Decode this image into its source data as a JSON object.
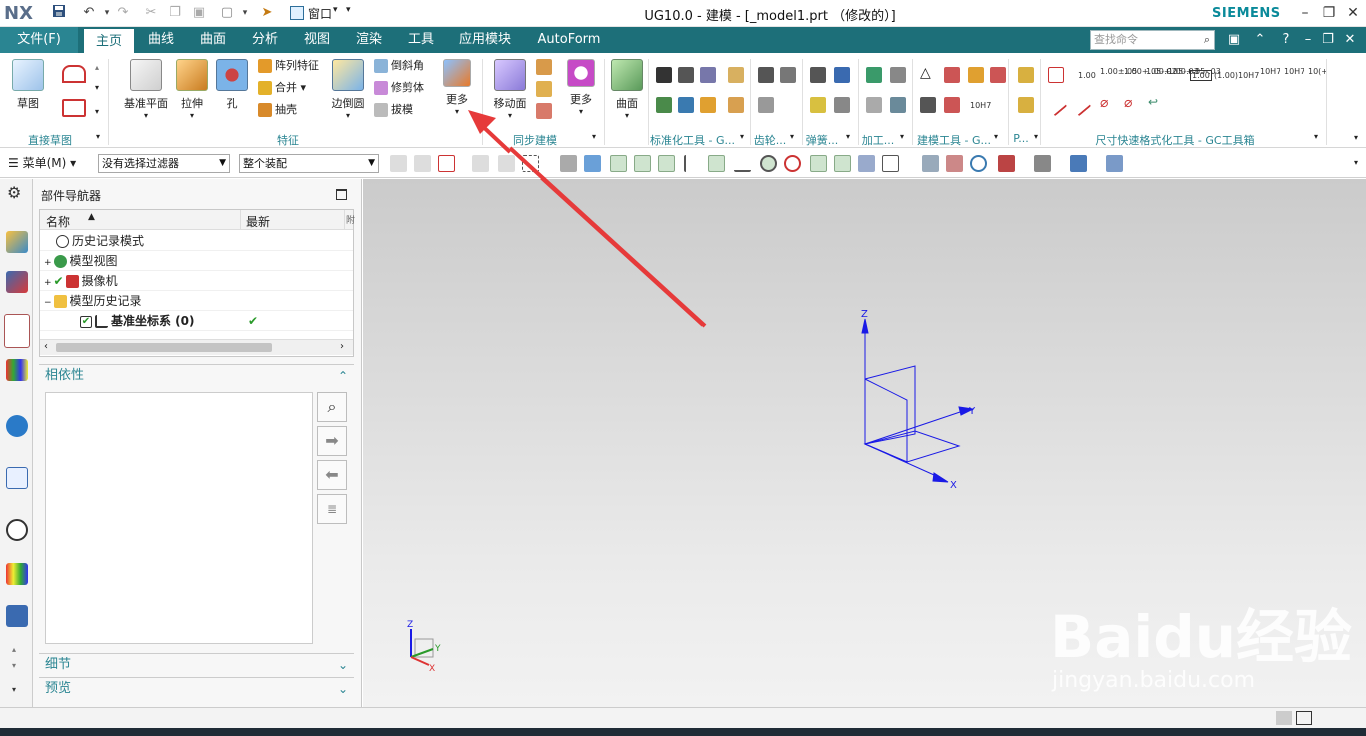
{
  "app": {
    "logo": "NX",
    "title": "UG10.0 - 建模 - [_model1.prt （修改的）]",
    "brand": "SIEMENS",
    "window_menu": "窗口",
    "accent": "#1d6f79",
    "brand_color": "#0a8a9a"
  },
  "tabs": [
    {
      "label": "文件(F)"
    },
    {
      "label": "主页"
    },
    {
      "label": "曲线"
    },
    {
      "label": "曲面"
    },
    {
      "label": "分析"
    },
    {
      "label": "视图"
    },
    {
      "label": "渲染"
    },
    {
      "label": "工具"
    },
    {
      "label": "应用模块"
    },
    {
      "label": "AutoForm"
    }
  ],
  "search": {
    "placeholder": "查找命令"
  },
  "ribbon": {
    "sketch": "草图",
    "datum_plane": "基准平面",
    "extrude": "拉伸",
    "hole": "孔",
    "pattern_feature": "阵列特征",
    "unite": "合并",
    "shell": "抽壳",
    "edge_blend": "边倒圆",
    "chamfer": "倒斜角",
    "trim_body": "修剪体",
    "draft": "拔模",
    "more1": "更多",
    "move_face": "移动面",
    "more2": "更多",
    "surface": "曲面",
    "groups": {
      "direct_sketch": "直接草图",
      "feature": "特征",
      "sync_modeling": "同步建模",
      "standard_tools": "标准化工具 - G...",
      "gear": "齿轮...",
      "spring": "弹簧...",
      "machining": "加工...",
      "modeling_tools": "建模工具 - G...",
      "p": "P...",
      "dim_tools": "尺寸快速格式化工具 - GC工具箱"
    },
    "dim_labels": [
      "1.00",
      "1.00±.05",
      "1.00+.05-.02",
      "1.00+.05-.03",
      "1.00+.05-.03",
      "1.00",
      "(1.00)",
      "10H7",
      "10H7(+.018/0)",
      "10H7(+.018)",
      "10(+.015/0)"
    ],
    "label_10h7": "10H7"
  },
  "toolbar2": {
    "menu": "菜单(M)",
    "filter": "没有选择过滤器",
    "assembly": "整个装配"
  },
  "navigator": {
    "title": "部件导航器",
    "col_name": "名称",
    "col_latest": "最新",
    "col_extra": "附",
    "rows": [
      {
        "label": "历史记录模式",
        "latest": ""
      },
      {
        "label": "模型视图",
        "latest": ""
      },
      {
        "label": "摄像机",
        "latest": ""
      },
      {
        "label": "模型历史记录",
        "latest": ""
      },
      {
        "label": "基准坐标系 (0)",
        "latest": "✔"
      }
    ],
    "dependency": "相依性",
    "details": "细节",
    "preview": "预览"
  },
  "graphics": {
    "axis_z": "Z",
    "axis_y": "Y",
    "axis_x": "X",
    "triad_z": "Z",
    "triad_y": "Y",
    "triad_x": "X"
  },
  "watermark": {
    "text": "Baidu经验",
    "url": "jingyan.baidu.com"
  }
}
